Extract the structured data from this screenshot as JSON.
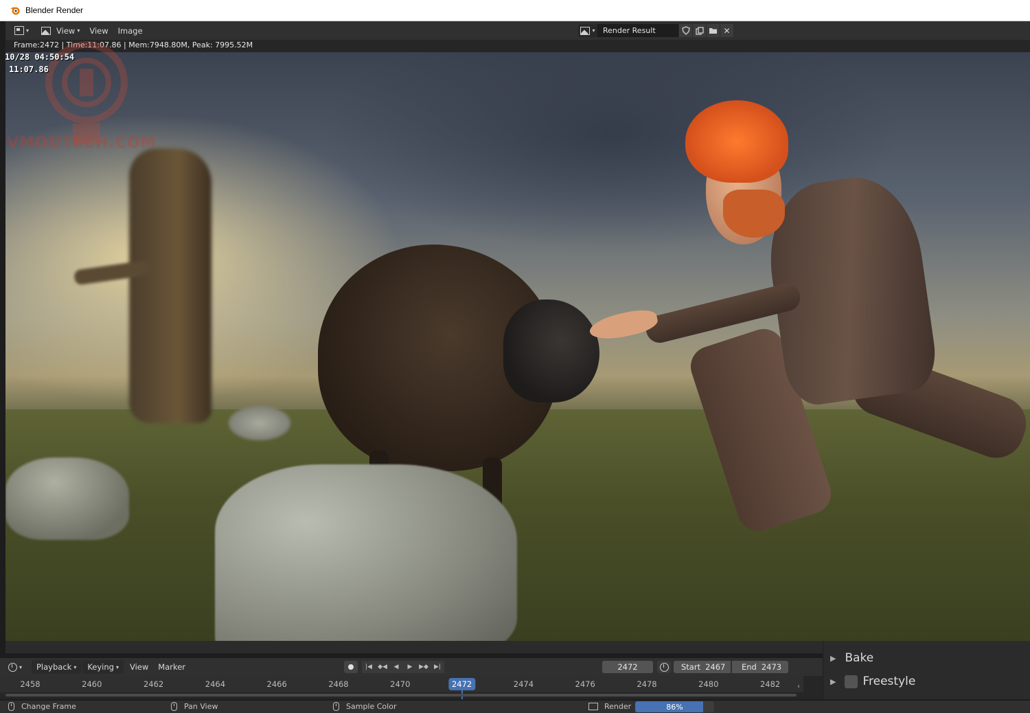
{
  "window": {
    "title": "Blender Render"
  },
  "image_editor": {
    "menus": [
      "View",
      "View",
      "Image"
    ],
    "image_name": "Render Result",
    "tool_icons": [
      "shield-icon",
      "duplicate-icon",
      "folder-icon",
      "close-icon"
    ]
  },
  "render_info": {
    "meta": "Frame:2472 | Time:11:07.86 | Mem:7948.80M, Peak: 7995.52M",
    "stamp_date": "10/28 04:50:54",
    "stamp_time": "11:07.86",
    "watermark": "VMODTECH.COM"
  },
  "timeline": {
    "menus": {
      "playback": "Playback",
      "keying": "Keying",
      "view": "View",
      "marker": "Marker"
    },
    "current_frame": "2472",
    "start_label": "Start",
    "start_value": "2467",
    "end_label": "End",
    "end_value": "2473",
    "ticks": [
      "2458",
      "2460",
      "2462",
      "2464",
      "2466",
      "2468",
      "2470",
      "2472",
      "2474",
      "2476",
      "2478",
      "2480",
      "2482"
    ],
    "current_tick_index": 7
  },
  "properties": {
    "bake": "Bake",
    "freestyle": "Freestyle",
    "freestyle_enabled": false
  },
  "statusbar": {
    "change_frame": "Change Frame",
    "pan_view": "Pan View",
    "sample_color": "Sample Color",
    "render_label": "Render",
    "progress_percent": 86,
    "progress_text": "86%"
  },
  "colors": {
    "accent": "#4772b3",
    "header": "#303030",
    "panel": "#2b2b2b"
  }
}
